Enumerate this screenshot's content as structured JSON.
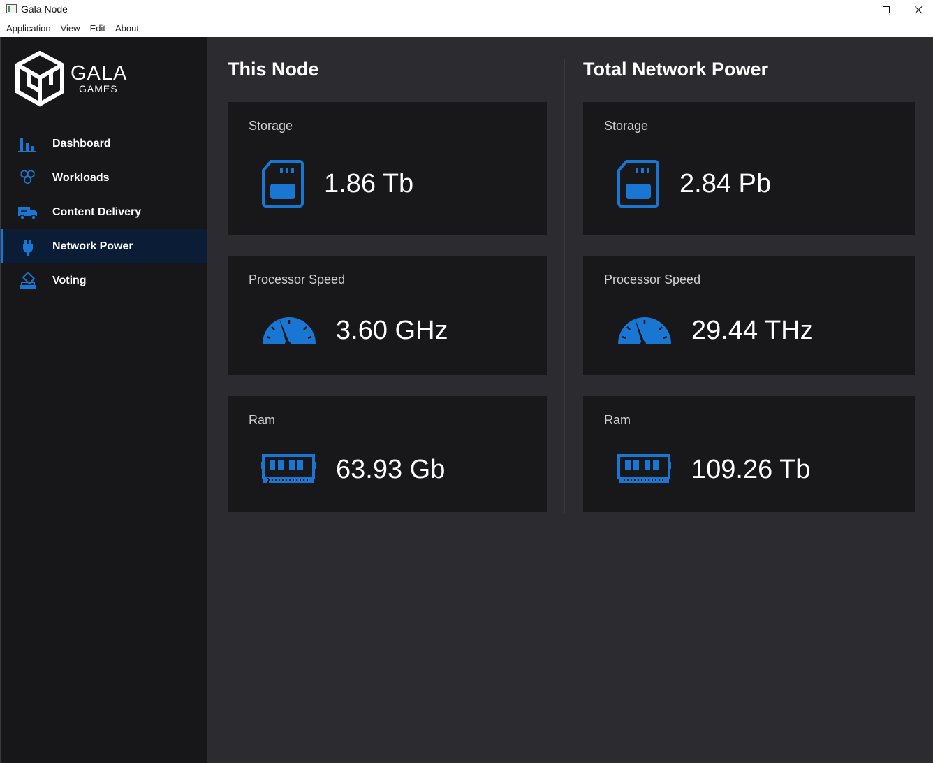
{
  "window": {
    "title": "Gala Node"
  },
  "menu": [
    "Application",
    "View",
    "Edit",
    "About"
  ],
  "brand": {
    "line1": "GALA",
    "line2": "GAMES"
  },
  "sidebar": {
    "items": [
      {
        "label": "Dashboard",
        "icon": "bar-chart-icon"
      },
      {
        "label": "Workloads",
        "icon": "hexagons-icon"
      },
      {
        "label": "Content Delivery",
        "icon": "delivery-truck-icon"
      },
      {
        "label": "Network Power",
        "icon": "power-plug-icon",
        "active": true
      },
      {
        "label": "Voting",
        "icon": "ballot-icon"
      }
    ]
  },
  "this_node": {
    "title": "This Node",
    "storage": {
      "label": "Storage",
      "value": "1.86 Tb"
    },
    "processor": {
      "label": "Processor Speed",
      "value": "3.60 GHz"
    },
    "ram": {
      "label": "Ram",
      "value": "63.93 Gb"
    }
  },
  "network": {
    "title": "Total Network Power",
    "storage": {
      "label": "Storage",
      "value": "2.84 Pb"
    },
    "processor": {
      "label": "Processor Speed",
      "value": "29.44 THz"
    },
    "ram": {
      "label": "Ram",
      "value": "109.26 Tb"
    }
  },
  "colors": {
    "accent": "#1976d2",
    "sidebar_bg": "#17171a",
    "main_bg": "#2b2b30",
    "card_bg": "#18181b",
    "active_bg": "#0b1d36"
  }
}
